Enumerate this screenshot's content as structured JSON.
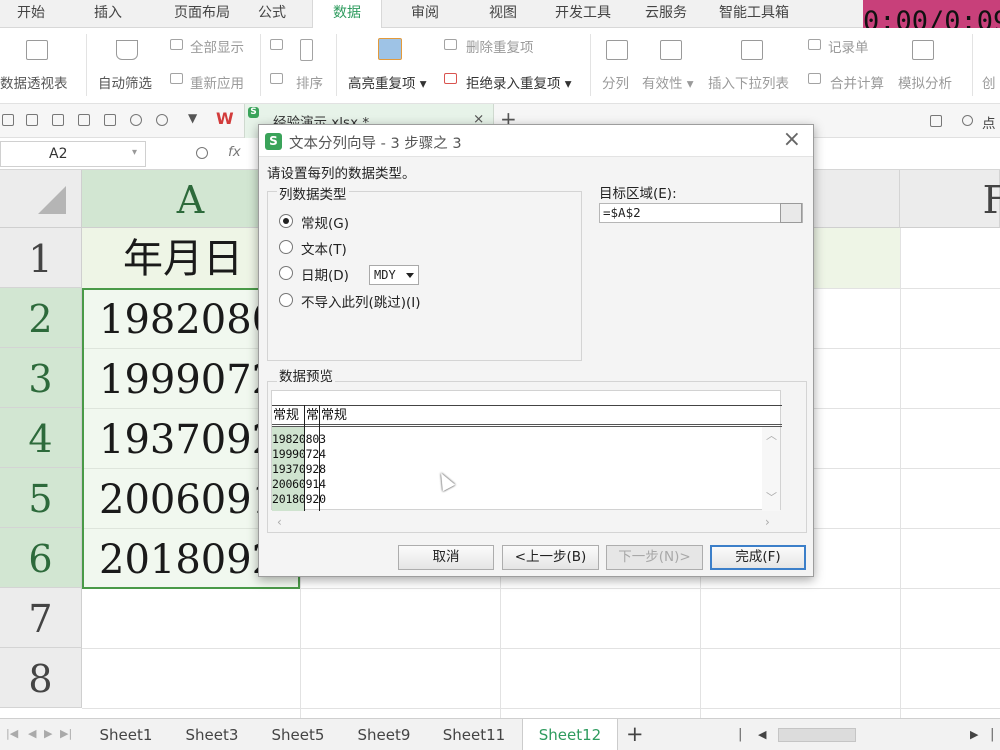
{
  "ribbon_tabs": [
    "开始",
    "插入",
    "页面布局",
    "公式",
    "数据",
    "审阅",
    "视图",
    "开发工具",
    "云服务",
    "智能工具箱"
  ],
  "active_tab": "数据",
  "timer": "0:00/0:09",
  "ribbon": {
    "pivot": "数据透视表",
    "autofilter": "自动筛选",
    "show_all": "全部显示",
    "reapply": "重新应用",
    "sort": "排序",
    "highlight_dup": "高亮重复项",
    "remove_dup": "删除重复项",
    "reject_dup": "拒绝录入重复项",
    "split": "分列",
    "validity": "有效性",
    "dropdown": "插入下拉列表",
    "record": "记录单",
    "merge_calc": "合并计算",
    "simulate": "模拟分析",
    "create": "创"
  },
  "quickbar": {
    "doc_name": "经验演示.xlsx *",
    "search": "点"
  },
  "formula_bar": {
    "name_box": "A2",
    "fx": "fx"
  },
  "sheet": {
    "col_a": "A",
    "col_f_partial": "F",
    "rows": [
      "1",
      "2",
      "3",
      "4",
      "5",
      "6",
      "7",
      "8"
    ],
    "a1": "年月日",
    "a_values": [
      "19820803",
      "19990724",
      "19370928",
      "20060914",
      "20180920"
    ]
  },
  "dialog": {
    "title": "文本分列向导 - 3 步骤之 3",
    "prompt": "请设置每列的数据类型。",
    "group_label": "列数据类型",
    "options": [
      "常规(G)",
      "文本(T)",
      "日期(D)",
      "不导入此列(跳过)(I)"
    ],
    "selected_option": "常规(G)",
    "date_format": "MDY",
    "target_label": "目标区域(E):",
    "target_value": "=$A$2",
    "preview_label": "数据预览",
    "preview_headers": [
      "常规",
      "常",
      "常规"
    ],
    "preview_rows": [
      "19820803",
      "19990724",
      "19370928",
      "20060914",
      "20180920"
    ],
    "buttons": {
      "cancel": "取消",
      "prev": "<上一步(B)",
      "next": "下一步(N)>",
      "finish": "完成(F)"
    }
  },
  "sheet_tabs": [
    "Sheet1",
    "Sheet3",
    "Sheet5",
    "Sheet9",
    "Sheet11",
    "Sheet12"
  ],
  "active_sheet": "Sheet12"
}
